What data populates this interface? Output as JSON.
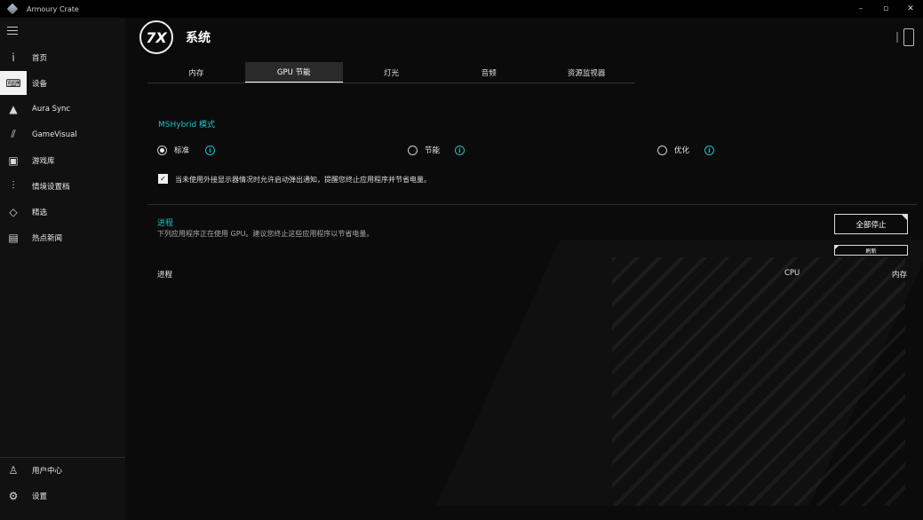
{
  "window": {
    "title": "Armoury Crate",
    "controls": [
      "–",
      "▫",
      "✕"
    ]
  },
  "sidebar": {
    "items": [
      {
        "label": "首页",
        "icon": "home-icon"
      },
      {
        "label": "设备",
        "icon": "device-icon"
      },
      {
        "label": "Aura Sync",
        "icon": "aura-icon"
      },
      {
        "label": "GameVisual",
        "icon": "gamevisual-icon"
      },
      {
        "label": "游戏库",
        "icon": "game-library-icon"
      },
      {
        "label": "情境设置档",
        "icon": "scenario-icon"
      },
      {
        "label": "精选",
        "icon": "tag-icon"
      },
      {
        "label": "热点新闻",
        "icon": "news-icon"
      }
    ],
    "bottom": [
      {
        "label": "用户中心",
        "icon": "user-icon"
      },
      {
        "label": "设置",
        "icon": "gear-icon"
      }
    ]
  },
  "page": {
    "logo_text": "7X",
    "title": "系统"
  },
  "tabs": [
    {
      "label": "内存"
    },
    {
      "label": "GPU 节能"
    },
    {
      "label": "灯光"
    },
    {
      "label": "音频"
    },
    {
      "label": "资源监视器"
    }
  ],
  "mshybrid": {
    "title": "MSHybrid 模式",
    "options": [
      "标准",
      "节能",
      "优化"
    ],
    "selected": "标准",
    "checkbox_label": "当未使用外接显示器情况时允许启动弹出通知，提醒您终止应用程序并节省电量。",
    "checkbox_checked": true
  },
  "process": {
    "title": "进程",
    "subtitle": "下列应用程序正在使用 GPU。建议您终止这些应用程序以节省电量。",
    "stop_all_label": "全部停止",
    "refresh_label": "刷新",
    "columns": [
      "进程",
      "CPU",
      "内存"
    ]
  },
  "colors": {
    "accent": "#19c2c8",
    "background": "#0b0b0b",
    "sidebar": "#111111"
  }
}
